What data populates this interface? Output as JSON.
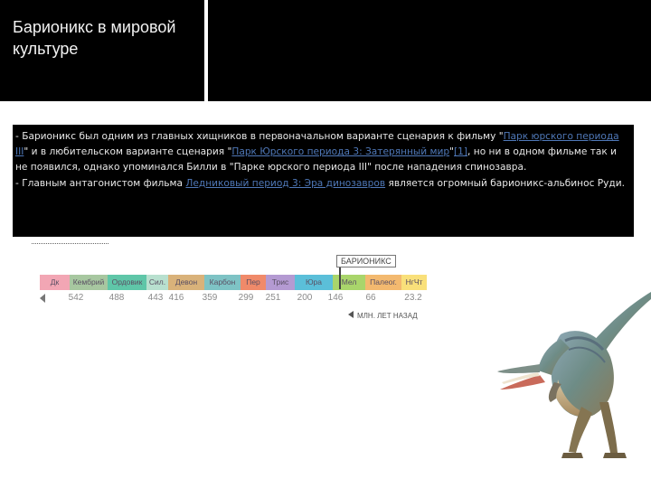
{
  "slide": {
    "title": "Барионикс в мировой культуре",
    "paragraph1": {
      "pre": " - Барионикс был одним из главных хищников в первоначальном варианте сценария к фильму \"",
      "link1": "Парк юрского периода III",
      "mid1": "\" и в любительском варианте сценария \"",
      "link2": "Парк Юрского периода 3: Затерянный мир",
      "mid2": "\"",
      "link3": "[1]",
      "post": ", но ни в одном фильме так и не появился, однако упоминался Билли в \"Парке юрского периода III\" после нападения спинозавра."
    },
    "paragraph2": {
      "pre": " - Главным антагонистом фильма ",
      "link": "Ледниковый период 3: Эра динозавров",
      "post": " является огромный барионикс-альбинос Руди."
    }
  },
  "timeline": {
    "flag_label": "БАРИОНИКС",
    "unit_label": "МЛН. ЛЕТ НАЗАД",
    "periods": [
      {
        "label": "Дк",
        "color": "#f2a6b4"
      },
      {
        "label": "Кембрий",
        "color": "#a7c7a0"
      },
      {
        "label": "Ордовик",
        "color": "#5fc6a8"
      },
      {
        "label": "Сил.",
        "color": "#b8e0cf"
      },
      {
        "label": "Девон",
        "color": "#d9b27a"
      },
      {
        "label": "Карбон",
        "color": "#7ec3c5"
      },
      {
        "label": "Пер",
        "color": "#f08a6a"
      },
      {
        "label": "Трис",
        "color": "#b49ad2"
      },
      {
        "label": "Юра",
        "color": "#5bbfd9"
      },
      {
        "label": "Мел",
        "color": "#a9d56b"
      },
      {
        "label": "Палеог.",
        "color": "#f3b96f"
      },
      {
        "label": "НгЧт",
        "color": "#f9e07a"
      }
    ],
    "ticks": [
      "542",
      "488",
      "443",
      "416",
      "359",
      "299",
      "251",
      "200",
      "146",
      "66",
      "23.2"
    ]
  }
}
